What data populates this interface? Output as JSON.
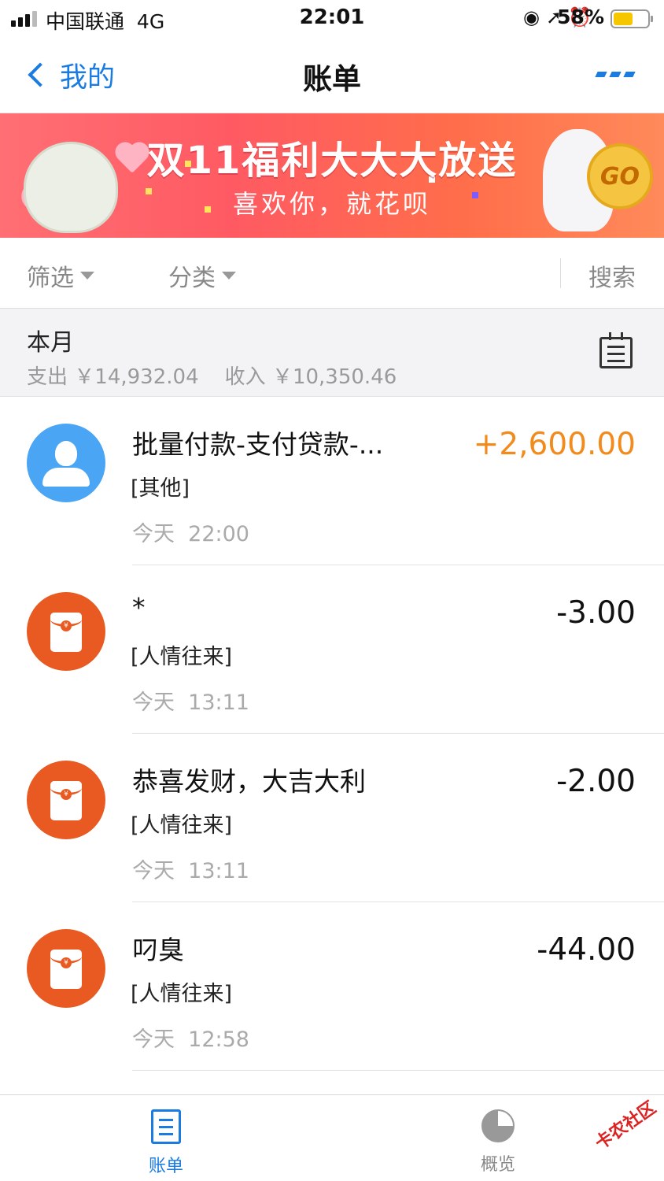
{
  "status_bar": {
    "carrier": "中国联通",
    "network": "4G",
    "time": "22:01",
    "battery_percent": "58%",
    "battery_level": 0.58
  },
  "nav": {
    "back_label": "我的",
    "title": "账单"
  },
  "banner": {
    "title": "双11福利大大大放送",
    "subtitle": "喜欢你，就花呗",
    "go_label": "GO"
  },
  "filters": {
    "filter_label": "筛选",
    "category_label": "分类",
    "search_label": "搜索"
  },
  "month": {
    "title": "本月",
    "expense_label": "支出",
    "expense_amount": "￥14,932.04",
    "income_label": "收入",
    "income_amount": "￥10,350.46"
  },
  "transactions": [
    {
      "title": "批量付款-支付贷款-...",
      "category": "[其他]",
      "day": "今天",
      "time": "22:00",
      "amount": "+2,600.00",
      "icon": "person-icon",
      "type": "income"
    },
    {
      "title": "*",
      "category": "[人情往来]",
      "day": "今天",
      "time": "13:11",
      "amount": "-3.00",
      "icon": "red-packet-icon",
      "type": "expense"
    },
    {
      "title": "恭喜发财，大吉大利",
      "category": "[人情往来]",
      "day": "今天",
      "time": "13:11",
      "amount": "-2.00",
      "icon": "red-packet-icon",
      "type": "expense"
    },
    {
      "title": "叼臭",
      "category": "[人情往来]",
      "day": "今天",
      "time": "12:58",
      "amount": "-44.00",
      "icon": "red-packet-icon",
      "type": "expense"
    }
  ],
  "tabbar": {
    "bill_label": "账单",
    "overview_label": "概览"
  },
  "watermark": "卡农社区",
  "colors": {
    "accent": "#1a7be0",
    "income": "#f28a1c",
    "red_packet": "#e85a22",
    "avatar_blue": "#4aa6f5"
  }
}
